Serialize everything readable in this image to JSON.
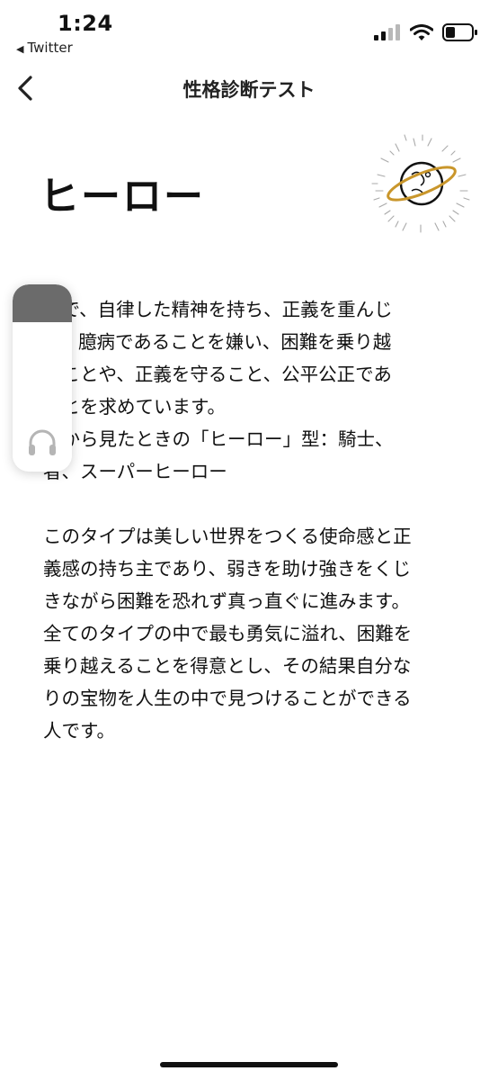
{
  "status_bar": {
    "time": "1:24",
    "back_app": "Twitter",
    "back_arrow": "◀",
    "icons": [
      "signal-icon",
      "wifi-icon",
      "battery-icon"
    ]
  },
  "nav": {
    "title": "性格診断テスト",
    "back_icon": "chevron-left-icon"
  },
  "result": {
    "title": "ヒーロー",
    "illustration": "planet-icon",
    "paragraphs": [
      "教で、自律した精神を持ち、正義を重んじ\nす。臆病であることを嫌い、困難を乗り越\nることや、正義を守ること、公平公正であ\nことを求めています。\n人から見たときの「ヒーロー」型：騎士、\n者、スーパーヒーロー",
      "このタイプは美しい世界をつくる使命感と正\n義感の持ち主であり、弱きを助け強きをくじ\nきながら困難を恐れず真っ直ぐに進みます。\n全てのタイプの中で最も勇気に溢れ、困難を\n乗り越えることを得意とし、その結果自分な\nりの宝物を人生の中で見つけることができる\n人です。"
    ]
  },
  "audio_widget": {
    "icon": "headphones-icon",
    "level": 0.2,
    "fill_color": "#6b6b6b"
  }
}
